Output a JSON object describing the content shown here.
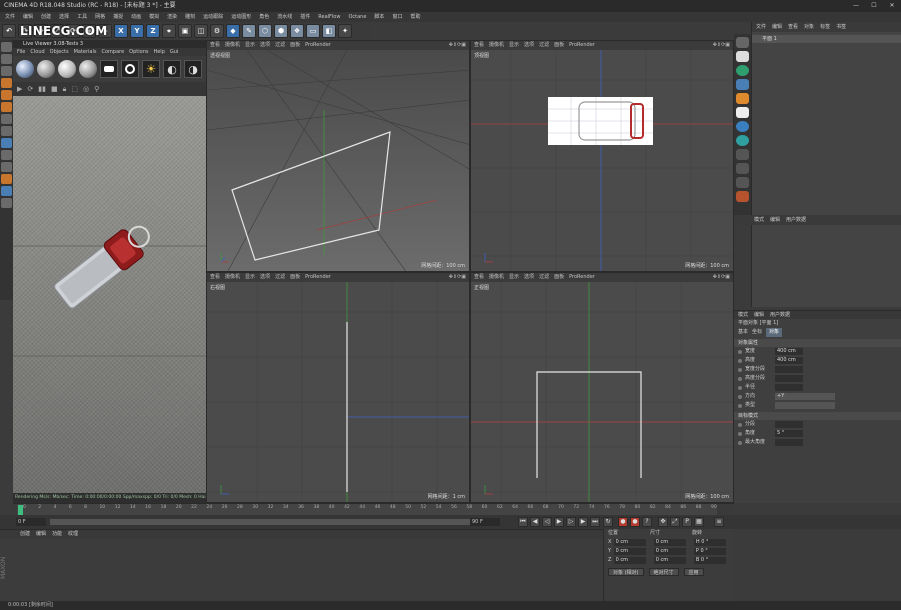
{
  "window": {
    "title": "CINEMA 4D R18.048 Studio (RC - R18) - [未标题 3 *] - 主要",
    "controls": [
      "—",
      "☐",
      "✕"
    ]
  },
  "menubar": [
    "文件",
    "编辑",
    "创建",
    "选择",
    "工具",
    "网格",
    "捕捉",
    "动画",
    "模拟",
    "渲染",
    "雕刻",
    "运动跟踪",
    "运动图形",
    "角色",
    "流水线",
    "插件",
    "RealFlow",
    "Octane",
    "脚本",
    "窗口",
    "帮助"
  ],
  "toolbar": {
    "logo": "LINECG.COM",
    "axis_x": "X",
    "axis_y": "Y",
    "axis_z": "Z"
  },
  "picture_viewer": {
    "title": "Live Viewer 3.08-Tests 3",
    "menu": [
      "File",
      "Cloud",
      "Objects",
      "Materials",
      "Compare",
      "Options",
      "Help",
      "Gui"
    ],
    "status": "Rendering  Ms/s:  Mb/sec:  Time: 0:00:00/0:00:00  Spp/maxspp: 0/0  Tri: 0/0  Mesh: 0  Hair: 0  GPU: 0"
  },
  "viewports": {
    "menu": [
      "查看",
      "摄像机",
      "显示",
      "选项",
      "过滤",
      "面板",
      "ProRender"
    ],
    "perspective": {
      "name": "透视视图",
      "scale": "网格间距：100 cm"
    },
    "top": {
      "name": "顶视图",
      "scale": "网格间距：100 cm"
    },
    "right": {
      "name": "右视图",
      "scale": "网格间距：1 cm"
    },
    "front": {
      "name": "正视图",
      "scale": "网格间距：100 cm"
    }
  },
  "object_manager": {
    "menu": [
      "文件",
      "编辑",
      "查看",
      "对象",
      "标签",
      "书签"
    ],
    "objects": [
      "平面 1"
    ]
  },
  "attribute_tabs": [
    "模式",
    "编辑",
    "用户数据"
  ],
  "attributes": {
    "header": "平面对象 [平面 1]",
    "tabs": [
      "基本",
      "坐标",
      "对象"
    ],
    "section": "对象属性",
    "props": [
      {
        "label": "宽度",
        "value": "400 cm"
      },
      {
        "label": "高度",
        "value": "400 cm"
      },
      {
        "label": "宽度分段",
        "value": ""
      },
      {
        "label": "高度分段",
        "value": ""
      },
      {
        "label": "半径",
        "value": ""
      },
      {
        "label": "方向",
        "value": "+Y"
      },
      {
        "label": "类型",
        "value": ""
      }
    ],
    "props2": [
      {
        "label": "分段",
        "value": ""
      },
      {
        "label": "角度",
        "value": "5 °"
      },
      {
        "label": "最大角度",
        "value": ""
      }
    ],
    "dropdown": "目标模式"
  },
  "timeline": {
    "ticks": [
      "0",
      "2",
      "4",
      "6",
      "8",
      "10",
      "12",
      "14",
      "16",
      "18",
      "20",
      "22",
      "24",
      "26",
      "28",
      "30",
      "32",
      "34",
      "36",
      "38",
      "40",
      "42",
      "44",
      "46",
      "48",
      "50",
      "52",
      "54",
      "56",
      "58",
      "60",
      "62",
      "64",
      "66",
      "68",
      "70",
      "72",
      "74",
      "76",
      "78",
      "80",
      "82",
      "84",
      "86",
      "88",
      "90"
    ],
    "start": "0 F",
    "end": "90 F",
    "current": "0 F"
  },
  "material_manager": {
    "menu": [
      "创建",
      "编辑",
      "功能",
      "纹理"
    ]
  },
  "coordinates": {
    "headers": [
      "位置",
      "尺寸",
      "旋转"
    ],
    "rows": [
      {
        "axis": "X",
        "pos": "0 cm",
        "size": "0 cm",
        "rot": "H 0 °"
      },
      {
        "axis": "Y",
        "pos": "0 cm",
        "size": "0 cm",
        "rot": "P 0 °"
      },
      {
        "axis": "Z",
        "pos": "0 cm",
        "size": "0 cm",
        "rot": "B 0 °"
      }
    ],
    "mode": "对象 (相对)",
    "size_mode": "绝对尺寸",
    "apply": "应用"
  },
  "statusbar": "0:00:03 [剩余时间]",
  "maxon": "MAXON"
}
